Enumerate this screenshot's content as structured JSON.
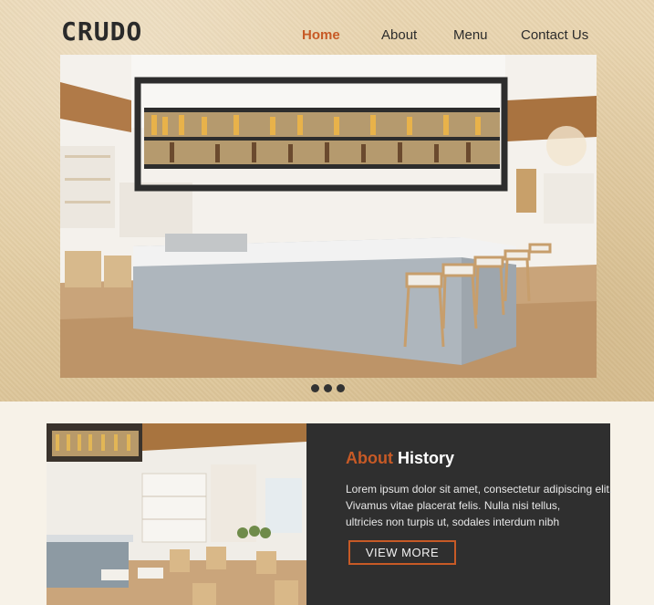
{
  "brand": {
    "logo": "CRUDO"
  },
  "nav": {
    "items": [
      {
        "label": "Home",
        "active": true
      },
      {
        "label": "About",
        "active": false
      },
      {
        "label": "Menu",
        "active": false
      },
      {
        "label": "Contact Us",
        "active": false
      }
    ]
  },
  "carousel": {
    "slide_count": 3
  },
  "about": {
    "title_accent": "About",
    "title_rest": "History",
    "lines": [
      "Lorem ipsum dolor sit amet, consectetur adipiscing elit.",
      "Vivamus vitae placerat felis. Nulla nisi tellus,",
      "ultricies non turpis ut, sodales interdum nibh"
    ],
    "button_label": "VIEW MORE"
  },
  "colors": {
    "accent": "#c75a26",
    "panel": "#2f2f2f",
    "text_dark": "#2c2c2c"
  }
}
